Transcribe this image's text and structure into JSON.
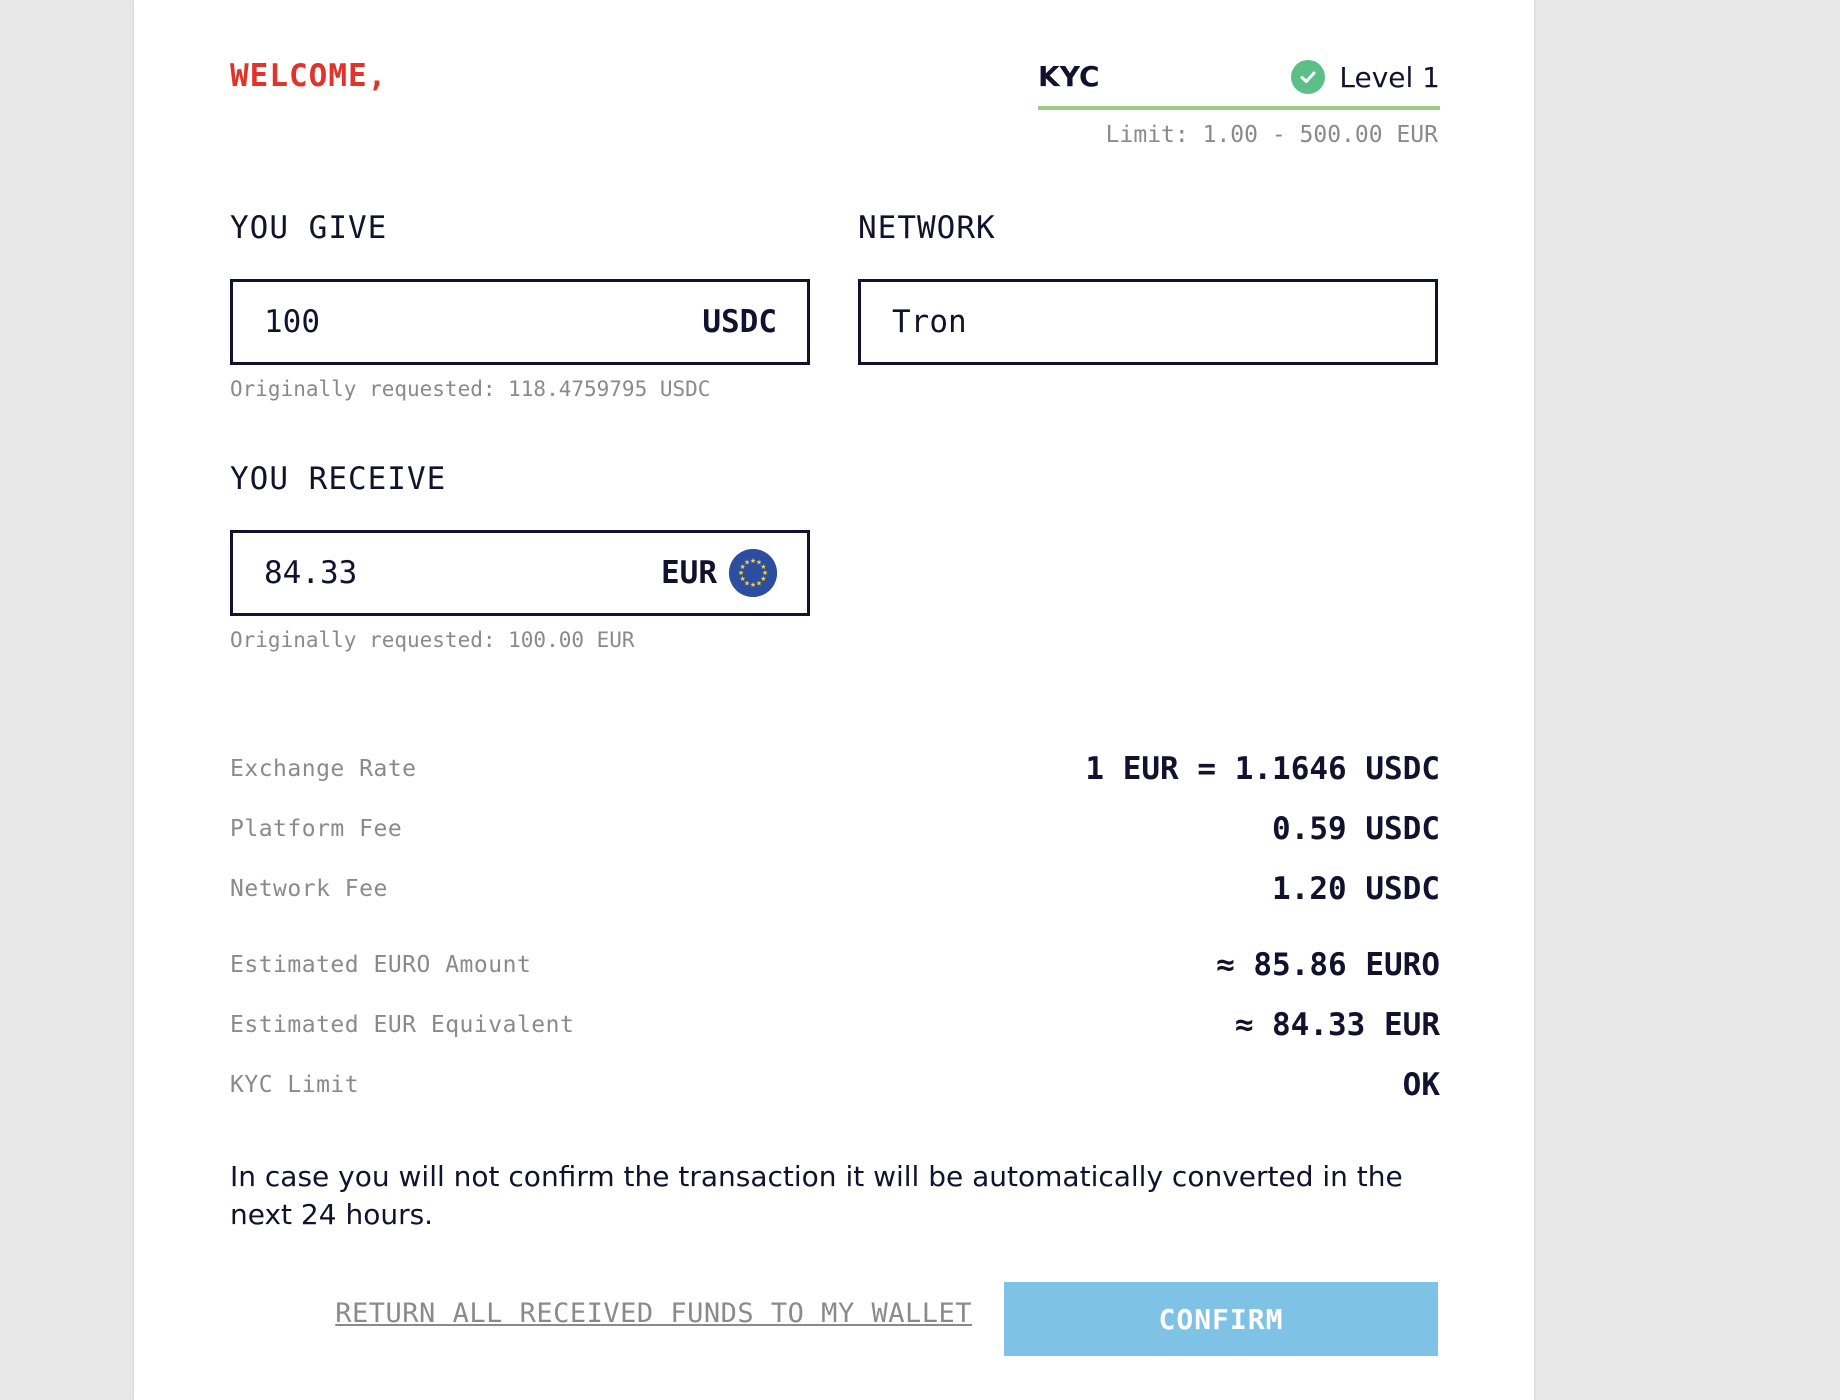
{
  "header": {
    "welcome": "WELCOME,",
    "kyc_label": "KYC",
    "kyc_level": "Level 1",
    "limit": "Limit: 1.00 - 500.00 EUR"
  },
  "give": {
    "title": "YOU GIVE",
    "value": "100",
    "unit": "USDC",
    "note": "Originally requested: 118.4759795 USDC"
  },
  "network": {
    "title": "NETWORK",
    "value": "Tron"
  },
  "receive": {
    "title": "YOU RECEIVE",
    "value": "84.33",
    "unit": "EUR",
    "unit_icon": "eu-flag-icon",
    "note": "Originally requested: 100.00 EUR"
  },
  "summary": [
    {
      "label": "Exchange Rate",
      "value": "1 EUR = 1.1646 USDC"
    },
    {
      "label": "Platform Fee",
      "value": "0.59 USDC"
    },
    {
      "label": "Network Fee",
      "value": "1.20 USDC"
    },
    {
      "label": "Estimated EURO Amount",
      "value": "≈ 85.86 EURO"
    },
    {
      "label": "Estimated EUR Equivalent",
      "value": "≈ 84.33 EUR"
    },
    {
      "label": "KYC Limit",
      "value": "OK"
    }
  ],
  "notice": "In case you will not confirm the transaction it will be automatically converted in the next 24 hours.",
  "actions": {
    "return_label": "RETURN ALL RECEIVED FUNDS TO MY WALLET",
    "confirm_label": "CONFIRM"
  },
  "colors": {
    "welcome": "#e2332a",
    "kyc_underline": "#9ccb82",
    "check": "#5cbf88",
    "confirm": "#7ec3e6",
    "eu_blue": "#2b4ea0"
  }
}
